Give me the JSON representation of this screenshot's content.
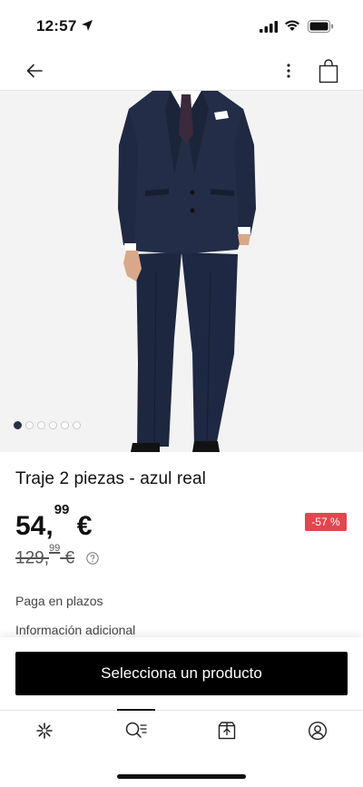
{
  "status_bar": {
    "time": "12:57"
  },
  "nav": {
    "back_icon": "arrow-left-icon",
    "more_icon": "more-vertical-icon",
    "bag_icon": "shopping-bag-icon"
  },
  "gallery": {
    "image_count": 6,
    "active_index": 0,
    "background": "#f3f3f3"
  },
  "product": {
    "title": "Traje 2 piezas - azul real",
    "price_int": "54,",
    "price_dec": "99",
    "price_currency": " €",
    "old_price_int": "129,",
    "old_price_dec": "99",
    "old_price_currency": " €",
    "discount": "-57 %",
    "discount_color": "#e2464f",
    "installments_label": "Paga en plazos",
    "additional_info_label": "Información adicional"
  },
  "cta": {
    "label": "Selecciona un producto"
  },
  "tab_bar": {
    "items": [
      {
        "icon": "home-sparkle-icon"
      },
      {
        "icon": "search-icon"
      },
      {
        "icon": "orders-box-icon"
      },
      {
        "icon": "account-icon"
      }
    ],
    "active_index": 1
  }
}
